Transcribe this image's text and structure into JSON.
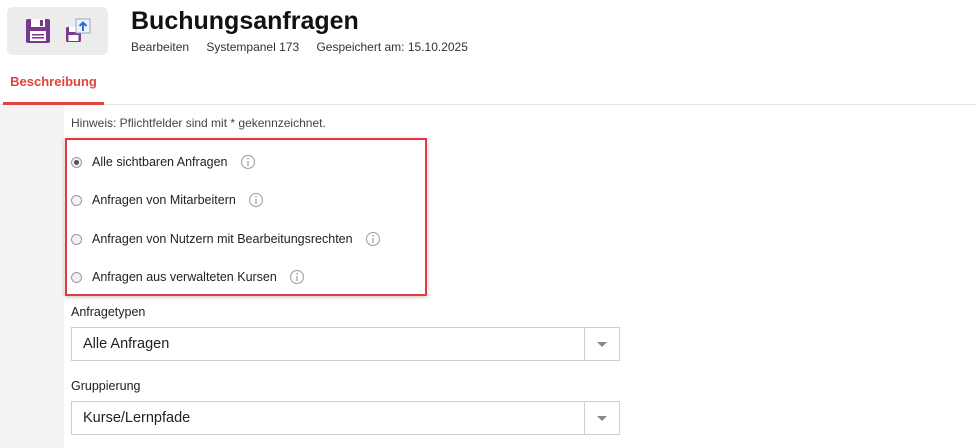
{
  "header": {
    "title": "Buchungsanfragen",
    "meta": [
      "Bearbeiten",
      "Systempanel 173",
      "Gespeichert am: 15.10.2025"
    ]
  },
  "tabs": [
    {
      "label": "Beschreibung",
      "active": true
    }
  ],
  "form": {
    "hint": "Hinweis: Pflichtfelder sind mit * gekennzeichnet.",
    "radio_options": [
      {
        "label": "Alle sichtbaren Anfragen",
        "checked": true
      },
      {
        "label": "Anfragen von Mitarbeitern",
        "checked": false
      },
      {
        "label": "Anfragen von Nutzern mit Bearbeitungsrechten",
        "checked": false
      },
      {
        "label": "Anfragen aus verwalteten Kursen",
        "checked": false
      }
    ],
    "anfragetypen": {
      "label": "Anfragetypen",
      "value": "Alle Anfragen"
    },
    "gruppierung": {
      "label": "Gruppierung",
      "value": "Kurse/Lernpfade"
    }
  },
  "colors": {
    "accent": "#e0443e",
    "icon": "#7a3a8c"
  }
}
